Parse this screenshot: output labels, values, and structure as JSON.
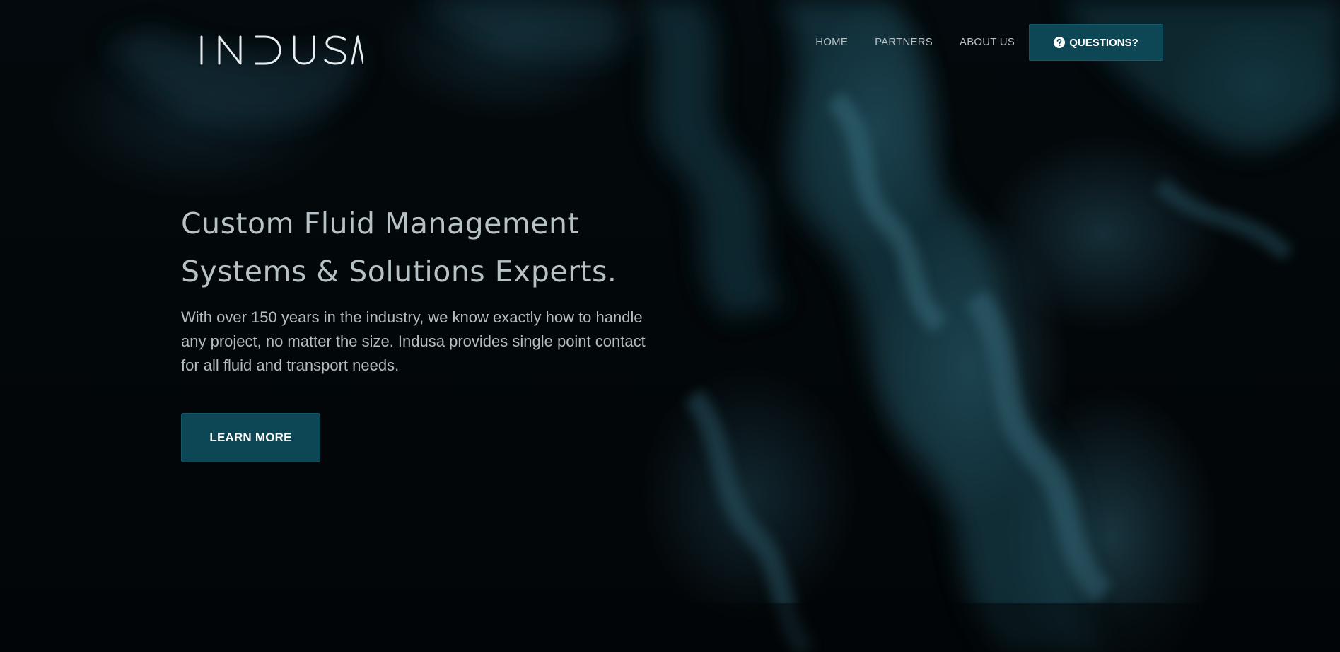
{
  "brand": {
    "logo_text": "INDUSA"
  },
  "nav": {
    "items": [
      {
        "label": "HOME"
      },
      {
        "label": "PARTNERS"
      },
      {
        "label": "ABOUT US"
      }
    ],
    "cta_label": "QUESTIONS?",
    "cta_icon": "question-circle-icon"
  },
  "hero": {
    "headline_line1": "Custom Fluid Management",
    "headline_line2": "Systems & Solutions Experts.",
    "subtext_line1": "With over 150 years in the industry, we know exactly how to handle",
    "subtext_line2": "any project, no matter the size. Indusa provides single point contact",
    "subtext_line3": "for all fluid and transport needs.",
    "button_label": "LEARN MORE"
  },
  "colors": {
    "accent": "#0d4654",
    "text_light": "#b6c2c6",
    "background": "#020608"
  }
}
